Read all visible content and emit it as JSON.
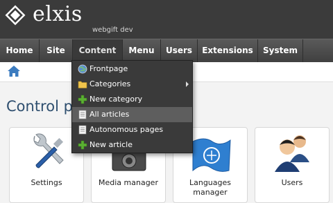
{
  "brand": {
    "name": "elxis",
    "site_name": "webgift dev"
  },
  "nav": {
    "items": [
      {
        "label": "Home"
      },
      {
        "label": "Site"
      },
      {
        "label": "Content"
      },
      {
        "label": "Menu"
      },
      {
        "label": "Users"
      },
      {
        "label": "Extensions"
      },
      {
        "label": "System"
      }
    ]
  },
  "content_menu": {
    "items": [
      {
        "label": "Frontpage",
        "icon": "globe-icon"
      },
      {
        "label": "Categories",
        "icon": "folder-icon"
      },
      {
        "label": "New category",
        "icon": "plus-icon"
      },
      {
        "label": "All articles",
        "icon": "document-icon"
      },
      {
        "label": "Autonomous pages",
        "icon": "document-icon"
      },
      {
        "label": "New article",
        "icon": "plus-icon"
      }
    ]
  },
  "page": {
    "title": "Control panel"
  },
  "cards": [
    {
      "label": "Settings",
      "icon": "tools-icon"
    },
    {
      "label": "Media manager",
      "icon": "camera-icon"
    },
    {
      "label": "Languages manager",
      "icon": "un-flag-icon"
    },
    {
      "label": "Users",
      "icon": "users-icon"
    }
  ],
  "colors": {
    "header": "#3b3b3b",
    "title": "#2f4f6f",
    "accent": "#3b7bbf"
  }
}
